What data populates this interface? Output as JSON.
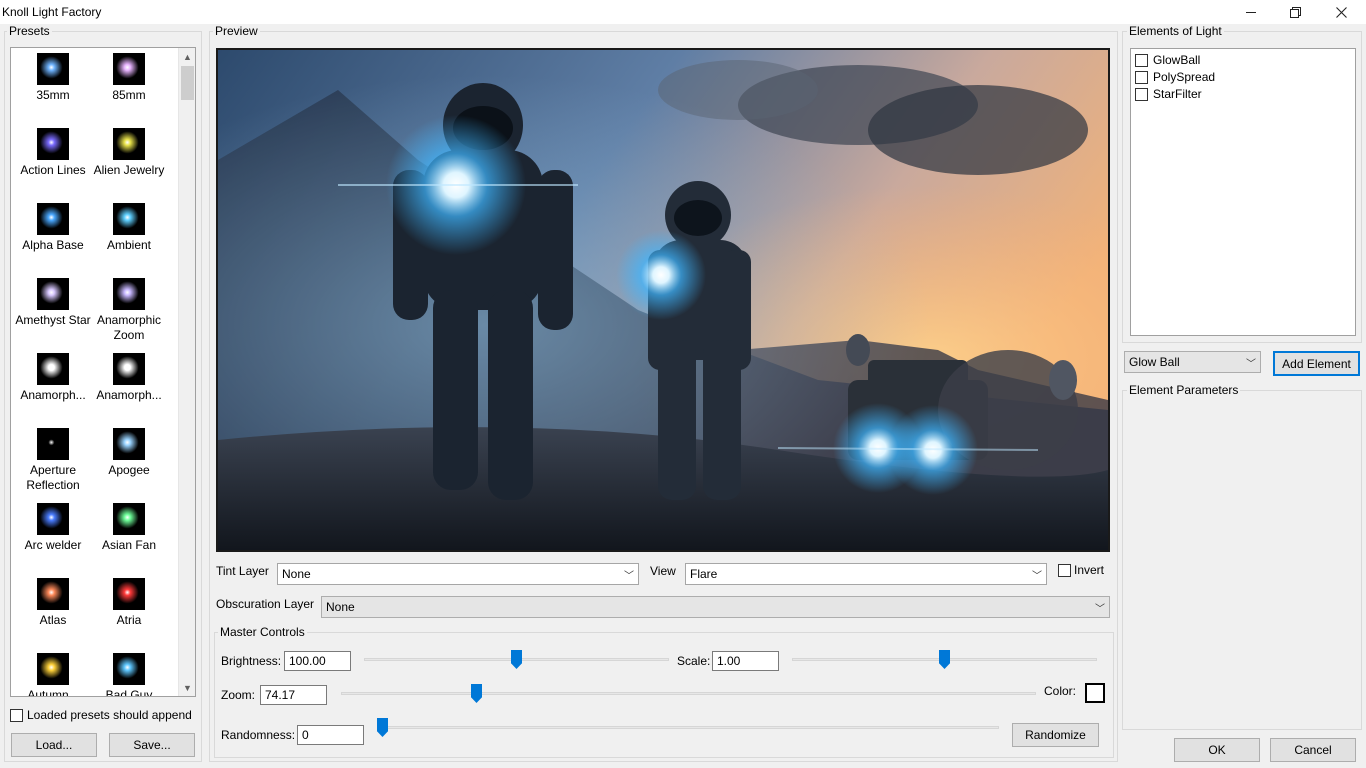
{
  "window": {
    "title": "Knoll Light Factory",
    "controls": [
      "minimize-icon",
      "restore-icon",
      "close-icon"
    ]
  },
  "presets": {
    "label": "Presets",
    "items": [
      {
        "label": "35mm",
        "thumb": "#6fb4ff"
      },
      {
        "label": "85mm",
        "thumb": "#e9b5ff"
      },
      {
        "label": "Action Lines",
        "thumb": "#7a6bff"
      },
      {
        "label": "Alien Jewelry",
        "thumb": "#e8e24a"
      },
      {
        "label": "Alpha Base",
        "thumb": "#4aa8ff"
      },
      {
        "label": "Ambient",
        "thumb": "#5fd0ff"
      },
      {
        "label": "Amethyst Star",
        "thumb": "#d8c8ff"
      },
      {
        "label": "Anamorphic Zoom",
        "thumb": "#c8b8ff"
      },
      {
        "label": "Anamorph...",
        "thumb": "#ffffff"
      },
      {
        "label": "Anamorph...",
        "thumb": "#ffffff"
      },
      {
        "label": "Aperture Reflection",
        "thumb": "#000000"
      },
      {
        "label": "Apogee",
        "thumb": "#9ad4ff"
      },
      {
        "label": "Arc welder",
        "thumb": "#4a7dff"
      },
      {
        "label": "Asian Fan",
        "thumb": "#6fff9a"
      },
      {
        "label": "Atlas",
        "thumb": "#ff8a5a"
      },
      {
        "label": "Atria",
        "thumb": "#ff3a3a"
      },
      {
        "label": "Autumn...",
        "thumb": "#ffd23a"
      },
      {
        "label": "Bad Guy",
        "thumb": "#5fc8ff"
      }
    ],
    "append_label": "Loaded presets should append",
    "load_label": "Load...",
    "save_label": "Save..."
  },
  "preview": {
    "label": "Preview"
  },
  "tint": {
    "label": "Tint Layer",
    "value": "None"
  },
  "view": {
    "label": "View",
    "value": "Flare",
    "invert_label": "Invert"
  },
  "obscuration": {
    "label": "Obscuration Layer",
    "value": "None"
  },
  "master": {
    "label": "Master Controls",
    "brightness_label": "Brightness:",
    "brightness_value": "100.00",
    "brightness_level": 0.5,
    "scale_label": "Scale:",
    "scale_value": "1.00",
    "scale_level": 0.5,
    "zoom_label": "Zoom:",
    "zoom_value": "74.17",
    "zoom_level": 0.19,
    "color_label": "Color:",
    "randomness_label": "Randomness:",
    "randomness_value": "0",
    "randomness_level": 0.0,
    "randomize_label": "Randomize"
  },
  "elements": {
    "label": "Elements of Light",
    "items": [
      "GlowBall",
      "PolySpread",
      "StarFilter"
    ],
    "select_value": "Glow Ball",
    "add_label": "Add Element",
    "params_label": "Element Parameters"
  },
  "dialog": {
    "ok_label": "OK",
    "cancel_label": "Cancel"
  },
  "colors": {
    "accent": "#0078d7",
    "flare": "#3fb6ff"
  }
}
